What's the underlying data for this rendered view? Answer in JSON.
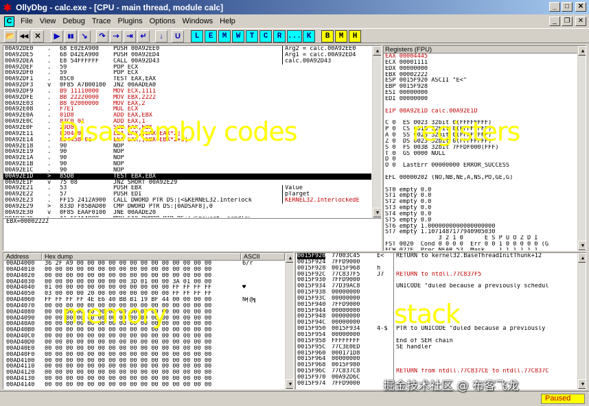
{
  "window": {
    "title": "OllyDbg - calc.exe - [CPU - main thread, module calc]",
    "logo": "✱"
  },
  "menu": {
    "cpu_box": "C",
    "items": [
      "File",
      "View",
      "Debug",
      "Trace",
      "Plugins",
      "Options",
      "Windows",
      "Help"
    ]
  },
  "titlebar_buttons": {
    "min": "_",
    "max": "□",
    "close": "✕"
  },
  "mdi_buttons": {
    "min": "_",
    "restore": "❐",
    "close": "✕"
  },
  "toolbar": {
    "icons": [
      "open-icon",
      "rewind-icon",
      "restart-icon",
      "close-icon",
      "run-icon",
      "pause-icon",
      "step-into-icon",
      "step-over-icon",
      "trace-into-icon",
      "trace-over-icon",
      "execute-till-return-icon",
      "go-to-icon"
    ],
    "glyphs": [
      "📂",
      "◀◀",
      "✕",
      "▶",
      "▮▮",
      "↘",
      "↷",
      "⇢",
      "⇥",
      "↵",
      "↓",
      "U"
    ],
    "letters": [
      "L",
      "E",
      "M",
      "W",
      "T",
      "C",
      "R",
      "...",
      "K",
      "B",
      "M",
      "H"
    ]
  },
  "disasm": {
    "rows": [
      {
        "addr": "00A92DE0",
        "mark": ".",
        "hex": "68 E02EA900",
        "cmd": "PUSH 00A92EE0",
        "cmt": "Arg2 = calc.00A92EE0"
      },
      {
        "addr": "00A92DE5",
        "mark": ".",
        "hex": "68 D42EA900",
        "cmd": "PUSH 00A92ED4",
        "cmt": "Arg1 = calc.00A92ED4"
      },
      {
        "addr": "00A92DEA",
        "mark": ".",
        "hex": "E8 54FFFFFF",
        "cmd": "CALL 00A92D43",
        "cmt": "calc.00A92D43"
      },
      {
        "addr": "00A92DEF",
        "mark": ".",
        "hex": "59",
        "cmd": "POP ECX",
        "cmt": ""
      },
      {
        "addr": "00A92DF0",
        "mark": ".",
        "hex": "59",
        "cmd": "POP ECX",
        "cmt": ""
      },
      {
        "addr": "00A92DF1",
        "mark": ".",
        "hex": "85C0",
        "cmd": "TEST EAX,EAX",
        "cmt": ""
      },
      {
        "addr": "00A92DF3",
        "mark": "v",
        "hex": "0F85 A7B00100",
        "cmd": "JNZ 00AADEA0",
        "cmt": ""
      },
      {
        "addr": "00A92DF9",
        "mark": ".",
        "hex": "B9 11110000",
        "cmd": "MOV ECX,1111",
        "cmt": "",
        "red": true
      },
      {
        "addr": "00A92DFE",
        "mark": ".",
        "hex": "BB 22220000",
        "cmd": "MOV EBX,2222",
        "cmt": "",
        "red": true
      },
      {
        "addr": "00A92E03",
        "mark": ".",
        "hex": "B8 02000000",
        "cmd": "MOV EAX,2",
        "cmt": "",
        "red": true
      },
      {
        "addr": "00A92E08",
        "mark": ".",
        "hex": "F7E1",
        "cmd": "MUL ECX",
        "cmt": "",
        "red": true
      },
      {
        "addr": "00A92E0A",
        "mark": ".",
        "hex": "01D8",
        "cmd": "ADD EAX,EBX",
        "cmt": "",
        "red": true
      },
      {
        "addr": "00A92E0C",
        "mark": ".",
        "hex": "83C0 01",
        "cmd": "ADD EAX,1",
        "cmt": "",
        "red": true
      },
      {
        "addr": "00A92E0F",
        "mark": ".",
        "hex": "29D8",
        "cmd": "SUB EAX,EBX",
        "cmt": "",
        "red": true
      },
      {
        "addr": "00A92E11",
        "mark": ".",
        "hex": "8D0440",
        "cmd": "LEA EAX,[EAX+EAX*2]",
        "cmt": "",
        "red": true
      },
      {
        "addr": "00A92E14",
        "mark": ".",
        "hex": "8D445B 01",
        "cmd": "LEA EAX,[EBX+EBX*2+1]",
        "cmt": "",
        "red": true
      },
      {
        "addr": "00A92E18",
        "mark": ".",
        "hex": "90",
        "cmd": "NOP",
        "cmt": ""
      },
      {
        "addr": "00A92E19",
        "mark": ".",
        "hex": "90",
        "cmd": "NOP",
        "cmt": ""
      },
      {
        "addr": "00A92E1A",
        "mark": ".",
        "hex": "90",
        "cmd": "NOP",
        "cmt": ""
      },
      {
        "addr": "00A92E1B",
        "mark": ".",
        "hex": "90",
        "cmd": "NOP",
        "cmt": ""
      },
      {
        "addr": "00A92E1C",
        "mark": ".",
        "hex": "90",
        "cmd": "NOP",
        "cmt": ""
      },
      {
        "addr": "00A92E1D",
        "mark": ">",
        "hex": "85DB",
        "cmd": "TEST EBX,EBX",
        "cmt": "",
        "sel": true
      },
      {
        "addr": "00A92E1F",
        "mark": "v",
        "hex": "75 08",
        "cmd": "JNZ SHORT 00A92E29",
        "cmt": ""
      },
      {
        "addr": "00A92E21",
        "mark": ".",
        "hex": "53",
        "cmd": "PUSH EBX",
        "cmt": "Value"
      },
      {
        "addr": "00A92E22",
        "mark": ".",
        "hex": "57",
        "cmd": "PUSH EDI",
        "cmt": "pTarget"
      },
      {
        "addr": "00A92E23",
        "mark": ".",
        "hex": "FF15 2412A900",
        "cmd": "CALL DWORD PTR DS:[<&KERNEL32.Interlock",
        "cmt": "KERNEL32.InterlockedE",
        "cmtred": true
      },
      {
        "addr": "00A92E29",
        "mark": ">",
        "hex": "833D F85BAD00",
        "cmd": "CMP DWORD PTR DS:[0ADSAF8],0",
        "cmt": ""
      },
      {
        "addr": "00A92E30",
        "mark": "v",
        "hex": "0F85 EAAF0100",
        "cmd": "JNE 00AADE20",
        "cmt": ""
      },
      {
        "addr": "00A92E36",
        "mark": ">",
        "hex": "A1 6C15A900",
        "cmd": "MOV EAX,DWORD PTR DS:[<&msvcrt._acmdln>",
        "cmt": ""
      },
      {
        "addr": "00A92E3B",
        "mark": ".",
        "hex": "8B30",
        "cmd": "MOV ESI,DWORD PTR DS:[EAX]",
        "cmt": ""
      },
      {
        "addr": "00A92E3D",
        "mark": ">",
        "hex": "8976 E0",
        "cmd": "MOV DWORD PTR SS:[EBP-20],ESI",
        "cmt": ""
      },
      {
        "addr": "00A92E40",
        "mark": ".",
        "hex": "8A06",
        "cmd": "MOV AL,BYTE PTR DS:[ESI]",
        "cmt": ""
      },
      {
        "addr": "00A92E42",
        "mark": ".",
        "hex": "3C 20",
        "cmd": "CMP AL,20",
        "cmt": ""
      }
    ],
    "info": "EBX=00002222",
    "label": "Disassembly codes"
  },
  "registers": {
    "header": "Registers (FPU)",
    "label": "registers",
    "rows": [
      {
        "t": "EAX 00004445",
        "red": true
      },
      {
        "t": "ECX 00001111"
      },
      {
        "t": "EDX 00000000"
      },
      {
        "t": "EBX 00002222"
      },
      {
        "t": "ESP 0015F920 ASCII \"E<\""
      },
      {
        "t": "EBP 0015F928"
      },
      {
        "t": "ESI 00000000"
      },
      {
        "t": "EDI 00000000"
      },
      {
        "t": ""
      },
      {
        "t": "EIP 00A92E1D calc.00A92E1D",
        "eip": true
      },
      {
        "t": ""
      },
      {
        "t": "C 0  ES 0023 32bit 0(FFFFFFFF)"
      },
      {
        "t": "P 0  CS 001B 32bit 0(FFFFFFFF)"
      },
      {
        "t": "A 0  SS 0023 32bit 0(FFFFFFFF)"
      },
      {
        "t": "Z 0  DS 0023 32bit 0(FFFFFFFF)"
      },
      {
        "t": "S 0  FS 003B 32bit 7FFDF000(FFF)"
      },
      {
        "t": "T 0  GS 0000 NULL"
      },
      {
        "t": "D 0"
      },
      {
        "t": "O 0  LastErr 00000000 ERROR_SUCCESS"
      },
      {
        "t": ""
      },
      {
        "t": "EFL 00000202 (NO,NB,NE,A,NS,PO,GE,G)"
      },
      {
        "t": ""
      },
      {
        "t": "ST0 empty 0.0"
      },
      {
        "t": "ST1 empty 0.0"
      },
      {
        "t": "ST2 empty 0.0"
      },
      {
        "t": "ST3 empty 0.0"
      },
      {
        "t": "ST4 empty 0.0"
      },
      {
        "t": "ST5 empty 0.0"
      },
      {
        "t": "ST6 empty 1.0000000000000000000"
      },
      {
        "t": "ST7 empty 1.1071487177940905030"
      },
      {
        "t": "               3 2 1 0      E S P U O Z D I"
      },
      {
        "t": "FST 0020  Cond 0 0 0 0  Err 0 0 1 0 0 0 0 0 (G"
      },
      {
        "t": "FCW 027F  Prec NEAR,53  Mask    1 1 1 1 1 1"
      },
      {
        "t": "Last cmnd 0000:751B13C"
      }
    ]
  },
  "dump": {
    "headers": {
      "address": "Address",
      "hex": "Hex dump",
      "ascii": "ASCII"
    },
    "label": "memory",
    "rows": [
      {
        "addr": "00AD4000",
        "hex": "36 2F A9 00 00 00 00 00 00 00 00 00 00 00 00 00",
        "asc": "6/r"
      },
      {
        "addr": "00AD4010",
        "hex": "00 00 00 00 00 00 00 00 00 00 00 00 00 00 00 00",
        "asc": ""
      },
      {
        "addr": "00AD4020",
        "hex": "00 00 00 00 00 00 00 00 00 00 00 00 00 00 00 00",
        "asc": ""
      },
      {
        "addr": "00AD4030",
        "hex": "00 00 00 00 00 00 00 00 3D 01 00 00 3A 01 00 00",
        "asc": ""
      },
      {
        "addr": "00AD4040",
        "hex": "01 00 00 00 00 00 00 00 00 00 00 00 FF FF FF FF",
        "asc": "♥"
      },
      {
        "addr": "00AD4050",
        "hex": "03 00 00 00 20 00 00 00 00 00 00 00 FF FF FF FF",
        "asc": ""
      },
      {
        "addr": "00AD4060",
        "hex": "FF FF FF FF 4E E6 40 BB B1 19 BF 44 00 00 00 00",
        "asc": "N╡@╗"
      },
      {
        "addr": "00AD4070",
        "hex": "00 00 00 00 00 00 00 00 00 00 00 00 00 00 00 00",
        "asc": ""
      },
      {
        "addr": "00AD4080",
        "hex": "00 00 00 00 00 00 00 00 00 00 00 00 00 00 00 00",
        "asc": ""
      },
      {
        "addr": "00AD4090",
        "hex": "00 00 00 00 00 00 00 00 00 00 00 00 00 00 00 00",
        "asc": ""
      },
      {
        "addr": "00AD40A0",
        "hex": "00 00 00 00 00 00 00 00 00 00 00 00 00 00 00 00",
        "asc": ""
      },
      {
        "addr": "00AD40B0",
        "hex": "00 00 00 00 00 00 00 00 00 00 00 00 00 00 00 00",
        "asc": ""
      },
      {
        "addr": "00AD40C0",
        "hex": "00 00 00 00 00 00 00 00 00 00 00 00 00 00 00 00",
        "asc": ""
      },
      {
        "addr": "00AD40D0",
        "hex": "00 00 00 00 00 00 00 00 00 00 00 00 00 00 00 00",
        "asc": ""
      },
      {
        "addr": "00AD40E0",
        "hex": "00 00 00 00 00 00 00 00 00 00 00 00 00 00 00 00",
        "asc": ""
      },
      {
        "addr": "00AD40F0",
        "hex": "00 00 00 00 00 00 00 00 00 00 00 00 00 00 00 00",
        "asc": ""
      },
      {
        "addr": "00AD4100",
        "hex": "00 00 00 00 00 00 00 00 00 00 00 00 00 00 00 00",
        "asc": ""
      },
      {
        "addr": "00AD4110",
        "hex": "00 00 00 00 00 00 00 00 00 00 00 00 00 00 00 00",
        "asc": ""
      },
      {
        "addr": "00AD4120",
        "hex": "00 00 00 00 00 00 00 00 00 00 00 00 00 00 00 00",
        "asc": ""
      },
      {
        "addr": "00AD4130",
        "hex": "00 00 00 00 00 00 00 00 00 00 00 00 00 00 00 00",
        "asc": ""
      },
      {
        "addr": "00AD4140",
        "hex": "00 00 00 00 00 00 00 00 00 00 00 00 00 00 00 00",
        "asc": ""
      }
    ]
  },
  "stack": {
    "label": "stack",
    "rows": [
      {
        "addr": "0015F920",
        "val": "77003C45",
        "asc": "E<",
        "cmt": "RETURN to kernel32.BaseThreadInitThunk+12",
        "sel": true
      },
      {
        "addr": "0015F924",
        "val": "7FFD9000",
        "asc": "",
        "cmt": ""
      },
      {
        "addr": "0015F928",
        "val": "0015F968",
        "asc": "h",
        "cmt": ""
      },
      {
        "addr": "0015F92C",
        "val": "77C837F5",
        "asc": "J7",
        "cmt": "RETURN to ntdll.77C837F5",
        "cmtred": true
      },
      {
        "addr": "0015F930",
        "val": "7FFD9000",
        "asc": "",
        "cmt": ""
      },
      {
        "addr": "0015F934",
        "val": "77D39AC8",
        "asc": "",
        "cmt": "UNICODE \"duled because a previously schedul"
      },
      {
        "addr": "0015F938",
        "val": "00000000",
        "asc": "",
        "cmt": ""
      },
      {
        "addr": "0015F93C",
        "val": "00000000",
        "asc": "",
        "cmt": ""
      },
      {
        "addr": "0015F940",
        "val": "7FFD9000",
        "asc": "",
        "cmt": ""
      },
      {
        "addr": "0015F944",
        "val": "00000000",
        "asc": "",
        "cmt": ""
      },
      {
        "addr": "0015F948",
        "val": "00000000",
        "asc": "",
        "cmt": ""
      },
      {
        "addr": "0015F94C",
        "val": "00000000",
        "asc": "",
        "cmt": ""
      },
      {
        "addr": "0015F950",
        "val": "0015F934",
        "asc": "4-$",
        "cmt": "PTR to UNICODE \"duled because a previously"
      },
      {
        "addr": "0015F954",
        "val": "00000000",
        "asc": "",
        "cmt": ""
      },
      {
        "addr": "0015F958",
        "val": "FFFFFFFF",
        "asc": "",
        "cmt": "End of SEH chain"
      },
      {
        "addr": "0015F95C",
        "val": "77C3E0ED",
        "asc": "",
        "cmt": "SE handler"
      },
      {
        "addr": "0015F960",
        "val": "000171D8",
        "asc": "",
        "cmt": ""
      },
      {
        "addr": "0015F964",
        "val": "00000000",
        "asc": "",
        "cmt": ""
      },
      {
        "addr": "0015F968",
        "val": "0015F980",
        "asc": "",
        "cmt": ""
      },
      {
        "addr": "0015F96C",
        "val": "77C837C8",
        "asc": "",
        "cmt": "RETURN from ntdll.77C837CE to ntdll.77C837C",
        "cmtred": true
      },
      {
        "addr": "0015F970",
        "val": "00A92D6C",
        "asc": "",
        "cmt": ""
      },
      {
        "addr": "0015F974",
        "val": "7FFD9000",
        "asc": "",
        "cmt": ""
      }
    ]
  },
  "status": {
    "state": "Paused"
  },
  "watermark": "掘金技术社区 @ 布客飞龙"
}
